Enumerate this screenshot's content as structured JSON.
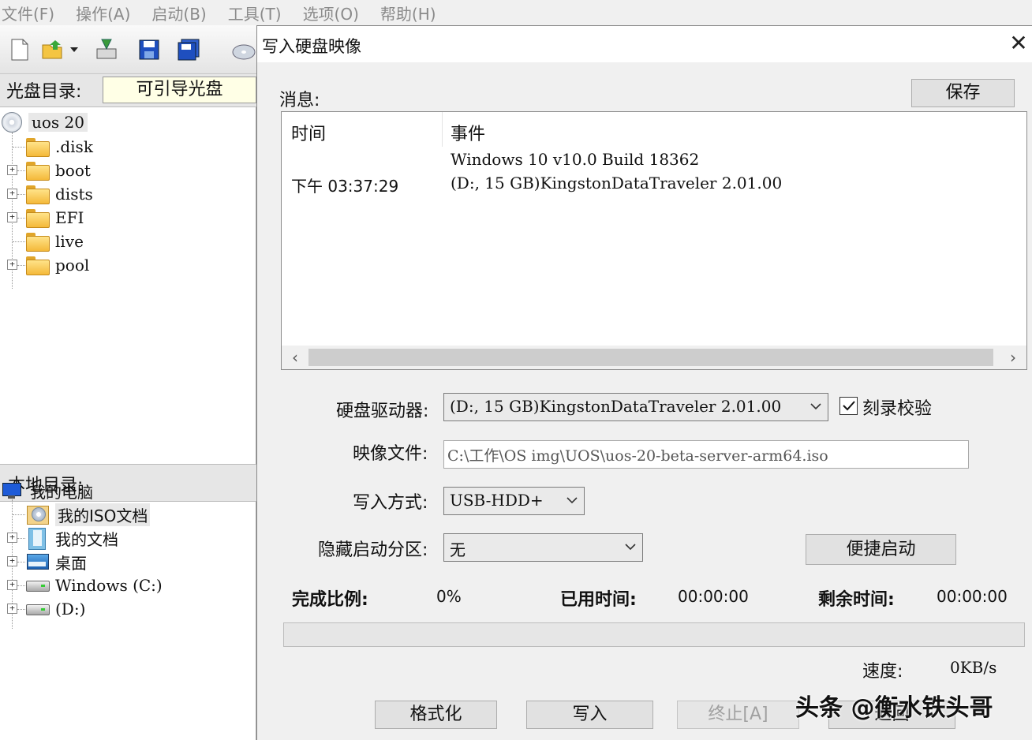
{
  "menu": [
    "文件(F)",
    "操作(A)",
    "启动(B)",
    "工具(T)",
    "选项(O)",
    "帮助(H)"
  ],
  "left": {
    "cd_label": "光盘目录:",
    "boot_box": "可引导光盘",
    "cd_root": "uos 20",
    "cd_items": [
      ".disk",
      "boot",
      "dists",
      "EFI",
      "live",
      "pool"
    ],
    "local_label": "本地目录:",
    "local_items": [
      "我的电脑",
      "我的ISO文档",
      "我的文档",
      "桌面",
      "Windows (C:)",
      "(D:)"
    ]
  },
  "dialog": {
    "title": "写入硬盘映像",
    "close": "✕",
    "message_label": "消息:",
    "save_button": "保存",
    "log": {
      "col_time": "时间",
      "col_event": "事件",
      "rows": [
        {
          "time": "",
          "event": "Windows 10 v10.0 Build 18362"
        },
        {
          "time": "下午 03:37:29",
          "event": "(D:, 15 GB)KingstonDataTraveler 2.01.00"
        }
      ]
    },
    "drive_label": "硬盘驱动器:",
    "drive_value": "(D:, 15 GB)KingstonDataTraveler 2.01.00",
    "verify_label": "刻录校验",
    "verify_checked": true,
    "image_label": "映像文件:",
    "image_value": "C:\\工作\\OS img\\UOS\\uos-20-beta-server-arm64.iso",
    "method_label": "写入方式:",
    "method_value": "USB-HDD+",
    "hidden_label": "隐藏启动分区:",
    "hidden_value": "无",
    "quick_boot_button": "便捷启动",
    "complete_label": "完成比例:",
    "complete_value": "0%",
    "elapsed_label": "已用时间:",
    "elapsed_value": "00:00:00",
    "remaining_label": "剩余时间:",
    "remaining_value": "00:00:00",
    "progress_fraction": 0,
    "speed_label": "速度:",
    "speed_value": "0KB/s",
    "format_button": "格式化",
    "write_button": "写入",
    "stop_button": "终止[A]",
    "back_button": "返回"
  },
  "watermark": "头条 @衡水铁头哥",
  "colors": {
    "progress_fill": "#06b025",
    "boot_box_bg": "#ffffe6"
  }
}
